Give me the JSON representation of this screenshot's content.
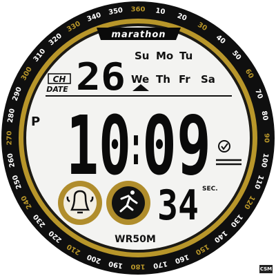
{
  "watch": {
    "brand": "marathon",
    "water_resistance": "WR50M",
    "badge": "CSM",
    "colors": {
      "bezel_black": "#0f0f0f",
      "bezel_gold": "#b8962a",
      "dial_bg": "#f3f3f1",
      "ink": "#0a0a0a",
      "button_gold": "#b08d2c"
    }
  },
  "bezel": {
    "labels": [
      "360",
      "10",
      "20",
      "30",
      "40",
      "50",
      "60",
      "70",
      "80",
      "90",
      "100",
      "110",
      "120",
      "130",
      "140",
      "150",
      "160",
      "170",
      "180",
      "190",
      "200",
      "210",
      "220",
      "230",
      "240",
      "250",
      "260",
      "270",
      "280",
      "290",
      "300",
      "310",
      "320",
      "330",
      "340",
      "350"
    ],
    "gold_labels": [
      "360",
      "30",
      "60",
      "90",
      "120",
      "150",
      "180",
      "210",
      "240",
      "270",
      "300",
      "330"
    ]
  },
  "display": {
    "date_ch_label": "CH",
    "date_label": "DATE",
    "date_value": "26",
    "weekdays_row1": [
      "Su",
      "Mo",
      "Tu"
    ],
    "weekdays_row2": [
      "We",
      "Th",
      "Fr",
      "Sa"
    ],
    "selected_weekday": "We",
    "ampm": "P",
    "time_hours": "10",
    "time_colon": ":",
    "time_minutes": "09",
    "seconds": "34",
    "seconds_label": "SEC.",
    "alarm_indicator_icon": "alarm-clock-icon"
  },
  "buttons": {
    "left_icon": "bell-icon",
    "right_icon": "runner-icon"
  }
}
